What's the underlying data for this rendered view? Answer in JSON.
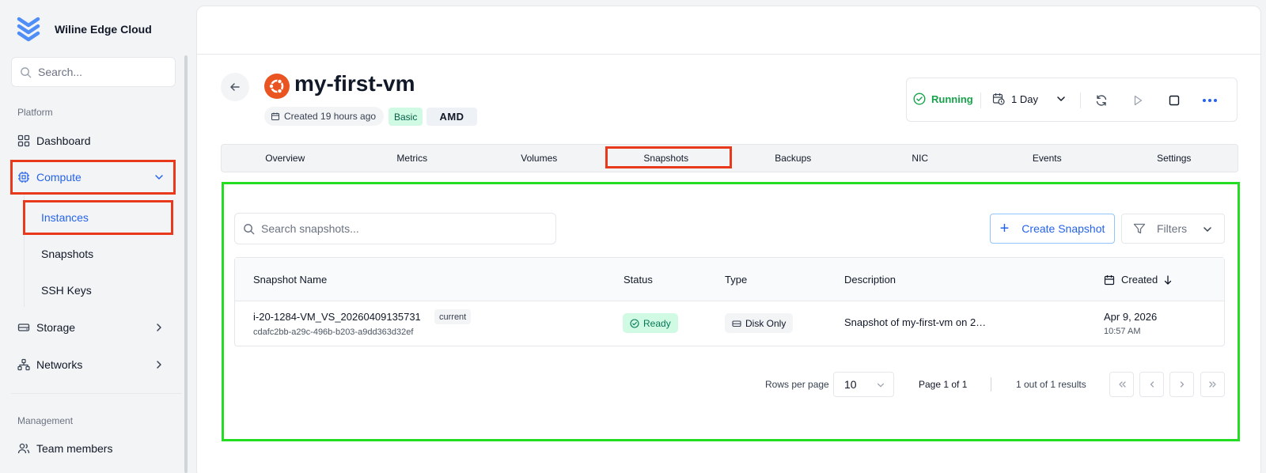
{
  "app": {
    "brand_name": "Wiline Edge Cloud"
  },
  "sidebar": {
    "search_placeholder": "Search...",
    "platform_label": "Platform",
    "management_label": "Management",
    "items": [
      {
        "label": "Dashboard",
        "icon": "grid-icon"
      },
      {
        "label": "Compute",
        "icon": "cpu-icon",
        "expanded": true
      },
      {
        "label": "Storage",
        "icon": "drive-icon"
      },
      {
        "label": "Networks",
        "icon": "network-icon"
      },
      {
        "label": "Team members",
        "icon": "users-icon"
      }
    ],
    "compute_sub": [
      {
        "label": "Instances"
      },
      {
        "label": "Snapshots"
      },
      {
        "label": "SSH Keys"
      }
    ]
  },
  "vm": {
    "name": "my-first-vm",
    "created": "Created 19 hours ago",
    "plan": "Basic",
    "cpu_vendor": "AMD",
    "status": "Running",
    "time_range": "1 Day"
  },
  "tabs": [
    "Overview",
    "Metrics",
    "Volumes",
    "Snapshots",
    "Backups",
    "NIC",
    "Events",
    "Settings"
  ],
  "snapshots": {
    "search_placeholder": "Search snapshots...",
    "create_label": "Create Snapshot",
    "filters_label": "Filters",
    "columns": {
      "name": "Snapshot Name",
      "status": "Status",
      "type": "Type",
      "description": "Description",
      "created": "Created"
    },
    "rows": [
      {
        "name": "i-20-1284-VM_VS_20260409135731",
        "tag": "current",
        "id": "cdafc2bb-a29c-496b-b203-a9dd363d32ef",
        "status": "Ready",
        "type": "Disk Only",
        "description": "Snapshot of my-first-vm on 2…",
        "date": "Apr 9, 2026",
        "time": "10:57 AM"
      }
    ],
    "pagination": {
      "rows_per_page_label": "Rows per page",
      "rows_per_page": "10",
      "page_info": "Page 1 of 1",
      "results": "1 out of 1 results"
    }
  },
  "colors": {
    "accent": "#2563eb",
    "running": "#16a34a",
    "ubuntu": "#e95420",
    "highlight_red": "#e8391d",
    "highlight_green": "#22dd22"
  }
}
